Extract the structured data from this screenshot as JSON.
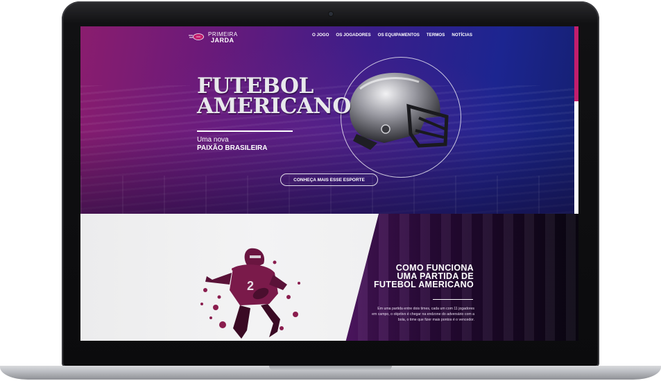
{
  "brand": {
    "name_line1": "PRIMEIRA",
    "name_line2": "JARDA"
  },
  "nav": {
    "items": [
      "O JOGO",
      "OS JOGADORES",
      "OS EQUIPAMENTOS",
      "TERMOS",
      "NOTÍCIAS"
    ]
  },
  "hero": {
    "title_line1": "FUTEBOL",
    "title_line2": "AMERICANO",
    "subtitle_line1": "Uma nova",
    "subtitle_line2": "PAIXÃO BRASILEIRA",
    "cta_label": "CONHEÇA MAIS ESSE ESPORTE"
  },
  "section2": {
    "title_line1": "COMO FUNCIONA",
    "title_line2": "UMA PARTIDA DE",
    "title_line3": "FUTEBOL AMERICANO",
    "body": "Em uma partida entre dois times, cada um com 11 jogadores em campo, o objetivo é chegar na endzone do adversário com a bola, o time que fizer mais pontos é o vencedor."
  },
  "colors": {
    "accent_pink": "#c21e6d",
    "hero_purple": "#6a1a7a",
    "hero_blue": "#1c2590"
  },
  "icons": {
    "logo": "football-icon",
    "helmet": "football-helmet-image",
    "player": "football-player-image"
  }
}
